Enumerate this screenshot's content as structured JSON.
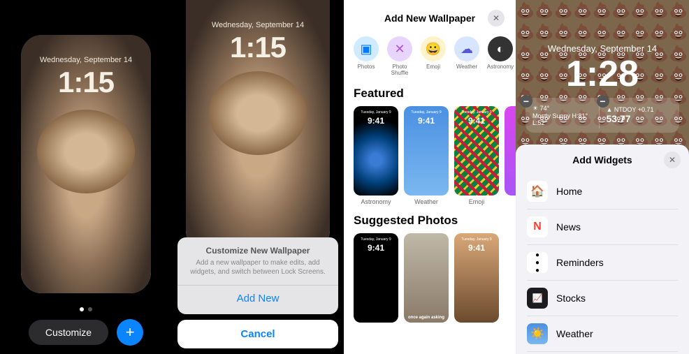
{
  "panel1": {
    "date": "Wednesday, September 14",
    "time": "1:15",
    "customize_label": "Customize",
    "plus_label": "+"
  },
  "panel2": {
    "date": "Wednesday, September 14",
    "time": "1:15",
    "sheet_title": "Customize New Wallpaper",
    "sheet_desc": "Add a new wallpaper to make edits, add widgets, and switch between Lock Screens.",
    "add_new": "Add New",
    "cancel": "Cancel"
  },
  "panel3": {
    "title": "Add New Wallpaper",
    "categories": [
      {
        "label": "Photos",
        "glyph": "▣"
      },
      {
        "label": "Photo Shuffle",
        "glyph": "✕"
      },
      {
        "label": "Emoji",
        "glyph": "😀"
      },
      {
        "label": "Weather",
        "glyph": "☁"
      },
      {
        "label": "Astronomy",
        "glyph": "◐"
      }
    ],
    "featured_title": "Featured",
    "featured": [
      {
        "label": "Astronomy",
        "time": "9:41",
        "date": "Tuesday, January 9"
      },
      {
        "label": "Weather",
        "time": "9:41",
        "date": "Tuesday, January 9"
      },
      {
        "label": "Emoji",
        "time": "9:41",
        "date": "Tuesday, January 9"
      }
    ],
    "suggested_title": "Suggested Photos",
    "suggested_time": "9:41",
    "suggested_caption": "once again asking"
  },
  "panel4": {
    "date": "Wednesday, September 14",
    "time": "1:28",
    "widget_left_top": "☀ 74°",
    "widget_left_bottom": "Mostly Sunny H:81° L:52°",
    "widget_right_top": "▲ NTDOY +0.71",
    "widget_right_bottom": "53.77",
    "add_widgets_title": "Add Widgets",
    "items": [
      {
        "label": "Home"
      },
      {
        "label": "News"
      },
      {
        "label": "Reminders"
      },
      {
        "label": "Stocks"
      },
      {
        "label": "Weather"
      }
    ]
  }
}
